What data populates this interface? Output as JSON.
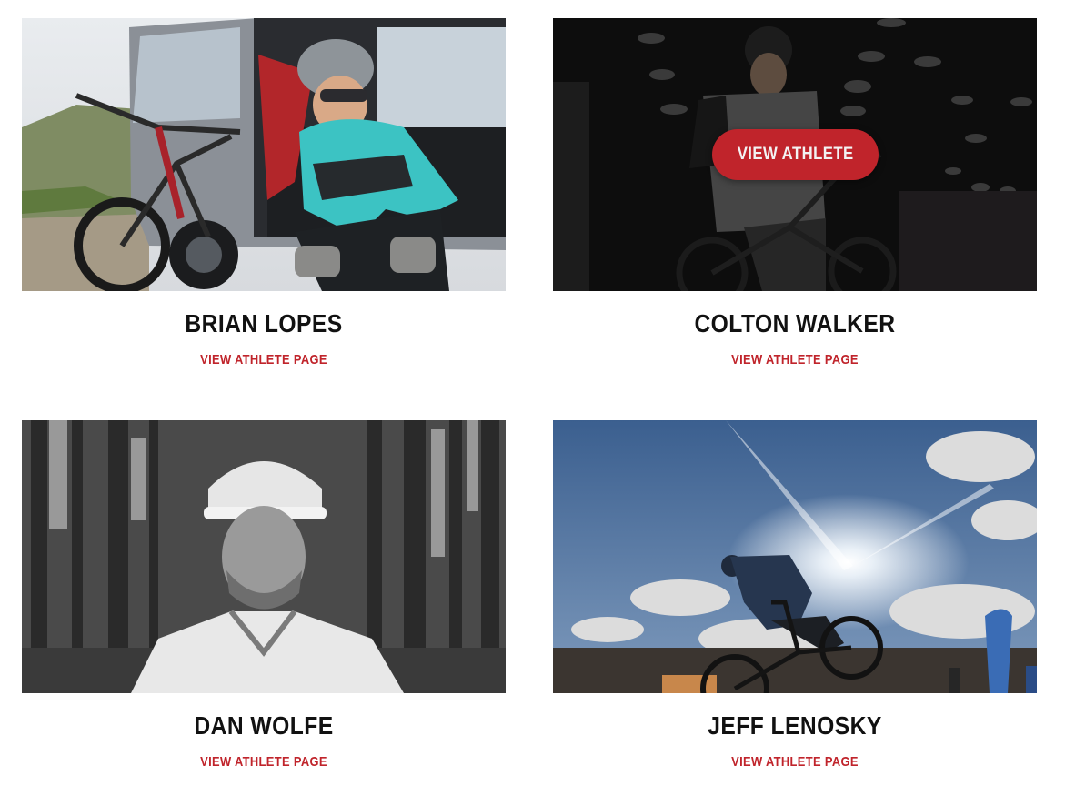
{
  "athletes": [
    {
      "name": "BRIAN LOPES",
      "link_label": "VIEW ATHLETE PAGE"
    },
    {
      "name": "COLTON WALKER",
      "link_label": "VIEW ATHLETE PAGE",
      "hover_button_label": "VIEW ATHLETE"
    },
    {
      "name": "DAN WOLFE",
      "link_label": "VIEW ATHLETE PAGE"
    },
    {
      "name": "JEFF LENOSKY",
      "link_label": "VIEW ATHLETE PAGE"
    }
  ],
  "colors": {
    "accent": "#c0242b",
    "name_text": "#111111",
    "background": "#ffffff"
  }
}
